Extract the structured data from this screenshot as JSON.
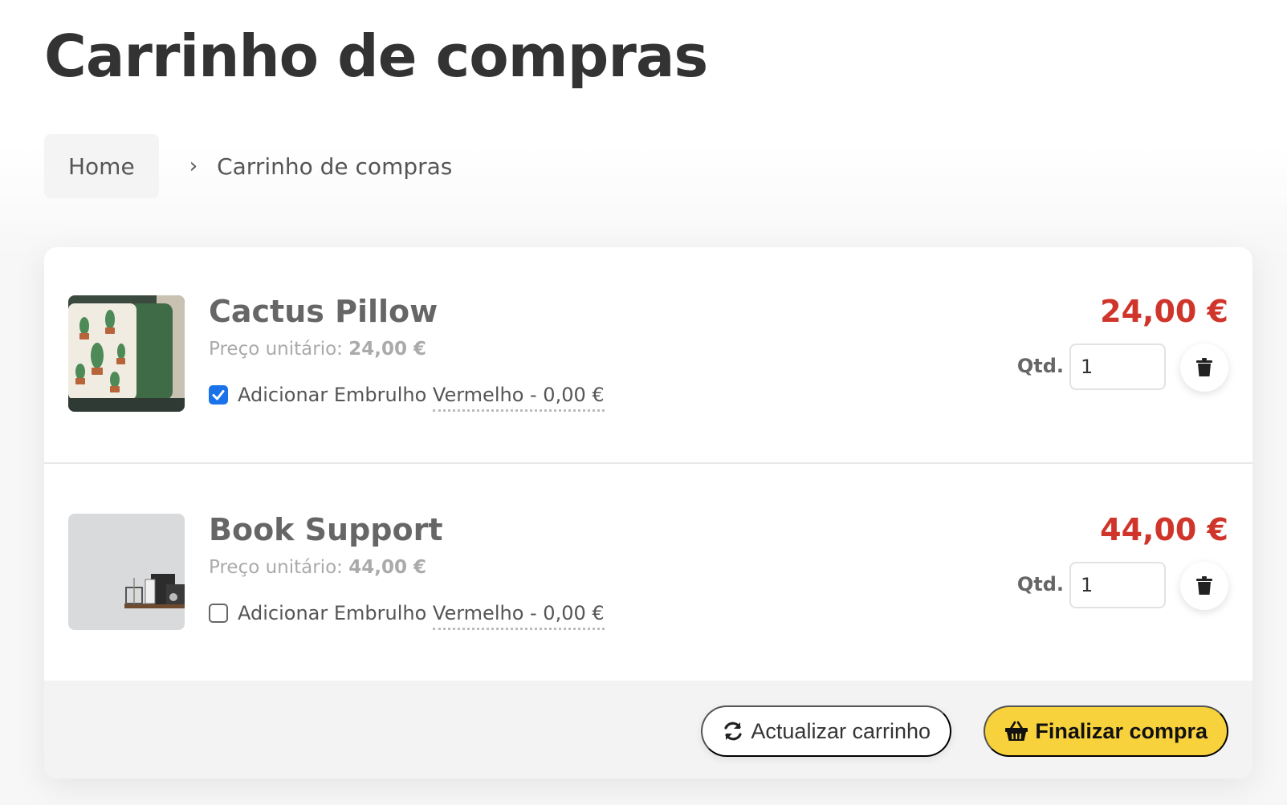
{
  "page": {
    "title": "Carrinho de compras"
  },
  "breadcrumb": {
    "home": "Home",
    "separator": "›",
    "current": "Carrinho de compras"
  },
  "cart": {
    "unit_price_label": "Preço unitário:",
    "qty_label": "Qtd.",
    "items": [
      {
        "name": "Cactus Pillow",
        "unit_price": "24,00 €",
        "gift_wrap_label_prefix": "Adicionar Embrulho ",
        "gift_wrap_label_link": "Vermelho - 0,00 €",
        "gift_wrap_checked": true,
        "quantity": "1",
        "total": "24,00 €",
        "image_icon": "cactus-pillow-photo"
      },
      {
        "name": "Book Support",
        "unit_price": "44,00 €",
        "gift_wrap_label_prefix": "Adicionar Embrulho ",
        "gift_wrap_label_link": "Vermelho - 0,00 €",
        "gift_wrap_checked": false,
        "quantity": "1",
        "total": "44,00 €",
        "image_icon": "book-support-photo"
      }
    ]
  },
  "actions": {
    "update_label": "Actualizar carrinho",
    "update_icon": "refresh-icon",
    "checkout_label": "Finalizar compra",
    "checkout_icon": "basket-icon"
  },
  "colors": {
    "price": "#d0352b",
    "checkout_bg": "#f8d23c",
    "checkbox_checked": "#1a73e8"
  }
}
